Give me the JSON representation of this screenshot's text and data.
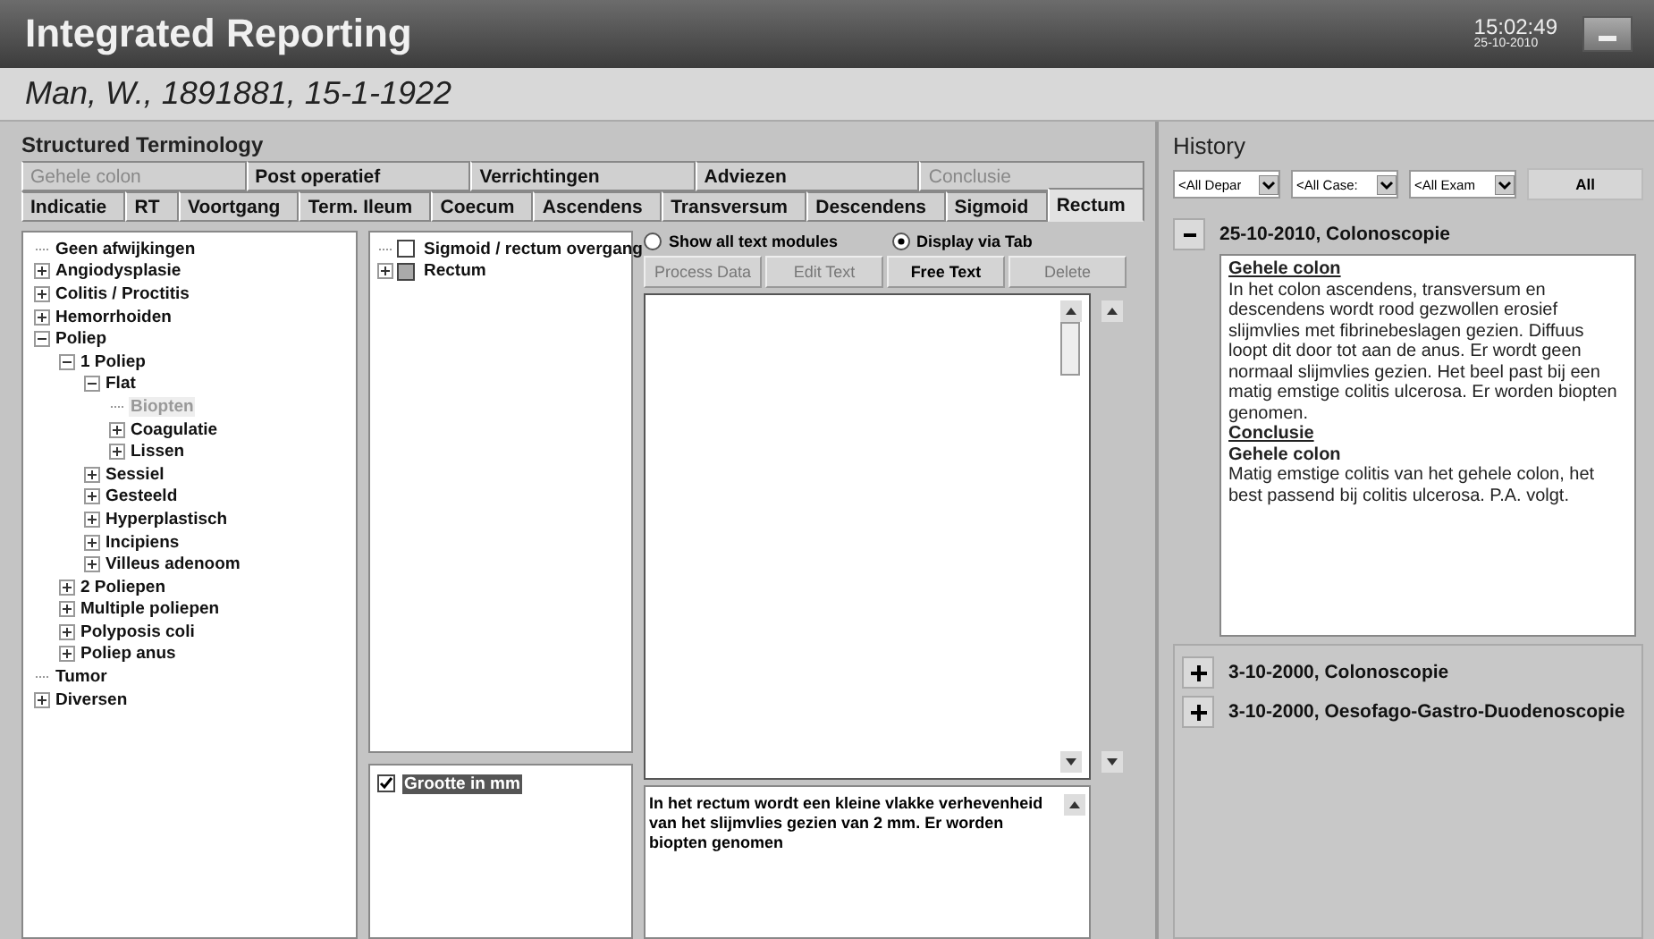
{
  "window": {
    "title": "Integrated Reporting",
    "time": "15:02:49",
    "date": "25-10-2010"
  },
  "patient": "Man, W., 1891881, 15-1-1922",
  "terminology": {
    "title": "Structured Terminology",
    "tab_rows": [
      [
        {
          "label": "Gehele colon",
          "selected": false,
          "disabled": true
        },
        {
          "label": "Post operatief",
          "selected": false,
          "disabled": false
        },
        {
          "label": "Verrichtingen",
          "selected": false,
          "disabled": false
        },
        {
          "label": "Adviezen",
          "selected": false,
          "disabled": false
        },
        {
          "label": "Conclusie",
          "selected": false,
          "disabled": true
        }
      ],
      [
        {
          "label": "Indicatie",
          "selected": false,
          "disabled": false
        },
        {
          "label": "RT",
          "selected": false,
          "disabled": false
        },
        {
          "label": "Voortgang",
          "selected": false,
          "disabled": false
        },
        {
          "label": "Term. Ileum",
          "selected": false,
          "disabled": false
        },
        {
          "label": "Coecum",
          "selected": false,
          "disabled": false
        },
        {
          "label": "Ascendens",
          "selected": false,
          "disabled": false
        },
        {
          "label": "Transversum",
          "selected": false,
          "disabled": false
        },
        {
          "label": "Descendens",
          "selected": false,
          "disabled": false
        },
        {
          "label": "Sigmoid",
          "selected": false,
          "disabled": false
        },
        {
          "label": "Rectum",
          "selected": true,
          "disabled": false
        }
      ]
    ],
    "tree": [
      {
        "label": "Geen afwijkingen",
        "kind": "leaf",
        "selected": false
      },
      {
        "label": "Angiodysplasie",
        "kind": "folder",
        "expanded": false,
        "selected": false
      },
      {
        "label": "Colitis / Proctitis",
        "kind": "folder",
        "expanded": false,
        "selected": false
      },
      {
        "label": "Hemorrhoiden",
        "kind": "folder",
        "expanded": false,
        "selected": false
      },
      {
        "label": "Poliep",
        "kind": "folder",
        "expanded": true,
        "selected": false,
        "children": [
          {
            "label": "1 Poliep",
            "kind": "folder",
            "expanded": true,
            "selected": false,
            "children": [
              {
                "label": "Flat",
                "kind": "folder",
                "expanded": true,
                "selected": false,
                "children": [
                  {
                    "label": "Biopten",
                    "kind": "leaf",
                    "selected": true
                  },
                  {
                    "label": "Coagulatie",
                    "kind": "folder",
                    "expanded": false,
                    "selected": false
                  },
                  {
                    "label": "Lissen",
                    "kind": "folder",
                    "expanded": false,
                    "selected": false
                  }
                ]
              },
              {
                "label": "Sessiel",
                "kind": "folder",
                "expanded": false,
                "selected": false
              },
              {
                "label": "Gesteeld",
                "kind": "folder",
                "expanded": false,
                "selected": false
              },
              {
                "label": "Hyperplastisch",
                "kind": "folder",
                "expanded": false,
                "selected": false
              },
              {
                "label": "Incipiens",
                "kind": "folder",
                "expanded": false,
                "selected": false
              },
              {
                "label": "Villeus adenoom",
                "kind": "folder",
                "expanded": false,
                "selected": false
              }
            ]
          },
          {
            "label": "2 Poliepen",
            "kind": "folder",
            "expanded": false,
            "selected": false
          },
          {
            "label": "Multiple poliepen",
            "kind": "folder",
            "expanded": false,
            "selected": false
          },
          {
            "label": "Polyposis coli",
            "kind": "folder",
            "expanded": false,
            "selected": false
          },
          {
            "label": "Poliep anus",
            "kind": "folder",
            "expanded": false,
            "selected": false
          }
        ]
      },
      {
        "label": "Tumor",
        "kind": "leaf",
        "selected": false
      },
      {
        "label": "Diversen",
        "kind": "folder",
        "expanded": false,
        "selected": false
      }
    ],
    "locations": [
      {
        "label": "Sigmoid / rectum overgang",
        "kind": "leaf",
        "checked": false,
        "partial": false
      },
      {
        "label": "Rectum",
        "kind": "folder",
        "expanded": false,
        "checked": false,
        "partial": true
      }
    ],
    "attributes": [
      {
        "label": "Grootte in mm",
        "checked": true,
        "selected": true
      }
    ],
    "radios": [
      {
        "label": "Show all text modules",
        "selected": false
      },
      {
        "label": "Display via Tab",
        "selected": true
      }
    ],
    "buttons": [
      {
        "label": "Process Data",
        "disabled": true
      },
      {
        "label": "Edit Text",
        "disabled": true
      },
      {
        "label": "Free Text",
        "disabled": false
      },
      {
        "label": "Delete",
        "disabled": true
      }
    ],
    "generated_text": "In het rectum wordt een kleine vlakke verhevenheid van het slijmvlies gezien van 2 mm. Er worden biopten genomen"
  },
  "history": {
    "title": "History",
    "filters": [
      {
        "value": "<All Depar"
      },
      {
        "value": "<All Case:"
      },
      {
        "value": "<All Exam"
      }
    ],
    "all_button": "All",
    "entries": [
      {
        "label": "25-10-2010, Colonoscopie",
        "expanded": true,
        "content": [
          {
            "kind": "heading",
            "text": "Gehele colon"
          },
          {
            "kind": "text",
            "text": "In het colon ascendens, transversum en descendens wordt rood gezwollen erosief slijmvlies met fibrinebeslagen gezien. Diffuus loopt dit door tot aan de anus. Er wordt geen normaal slijmvlies gezien. Het beel past bij een matig emstige colitis ulcerosa. Er worden biopten genomen."
          },
          {
            "kind": "heading",
            "text": "Conclusie"
          },
          {
            "kind": "subheading",
            "text": "Gehele colon"
          },
          {
            "kind": "text",
            "text": "Matig emstige colitis van het gehele colon, het best passend bij colitis ulcerosa. P.A. volgt."
          }
        ]
      },
      {
        "label": "3-10-2000, Colonoscopie",
        "expanded": false
      },
      {
        "label": "3-10-2000, Oesofago-Gastro-Duodenoscopie",
        "expanded": false
      }
    ]
  }
}
